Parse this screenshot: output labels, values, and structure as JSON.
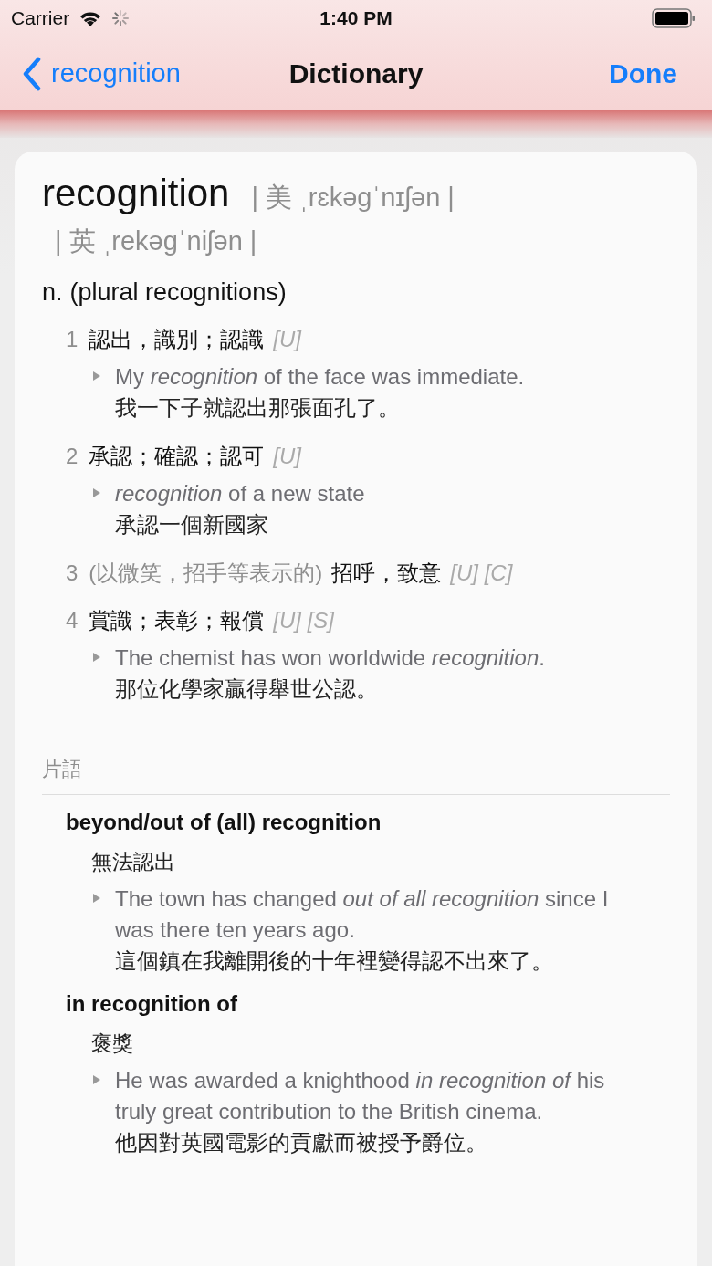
{
  "status_bar": {
    "carrier": "Carrier",
    "time": "1:40 PM"
  },
  "nav": {
    "back": "recognition",
    "title": "Dictionary",
    "done": "Done"
  },
  "entry": {
    "headword": "recognition",
    "pronunciations": [
      "| 美 ˌrɛkəɡˈnɪʃən |",
      "| 英 ˌrekəɡˈniʃən |"
    ],
    "pos": "n.",
    "inflection": "(plural recognitions)",
    "senses": [
      {
        "number": "1",
        "definition": "認出，識別；認識",
        "grammar": "[U]",
        "examples": [
          {
            "en": "My *recognition* of the face was immediate.",
            "zh": "我一下子就認出那張面孔了。"
          }
        ]
      },
      {
        "number": "2",
        "definition": "承認；確認；認可",
        "grammar": "[U]",
        "examples": [
          {
            "en": "*recognition* of a new state",
            "zh": "承認一個新國家"
          }
        ]
      },
      {
        "number": "3",
        "note": "(以微笑，招手等表示的)",
        "definition": "招呼，致意",
        "grammar": "[U] [C]"
      },
      {
        "number": "4",
        "definition": "賞識；表彰；報償",
        "grammar": "[U] [S]",
        "examples": [
          {
            "en": "The chemist has won worldwide *recognition*.",
            "zh": "那位化學家贏得舉世公認。"
          }
        ]
      }
    ]
  },
  "phrases": {
    "heading": "片語",
    "items": [
      {
        "phrase": "beyond/out of (all) recognition",
        "definition": "無法認出",
        "examples": [
          {
            "en": "The town has changed *out of all recognition* since I was there ten years ago.",
            "zh": "這個鎮在我離開後的十年裡變得認不出來了。"
          }
        ]
      },
      {
        "phrase": "in recognition of",
        "definition": "褒獎",
        "examples": [
          {
            "en": "He was awarded a knighthood *in recognition of* his truly great contribution to the British cinema.",
            "zh": "他因對英國電影的貢獻而被授予爵位。"
          }
        ]
      }
    ]
  }
}
